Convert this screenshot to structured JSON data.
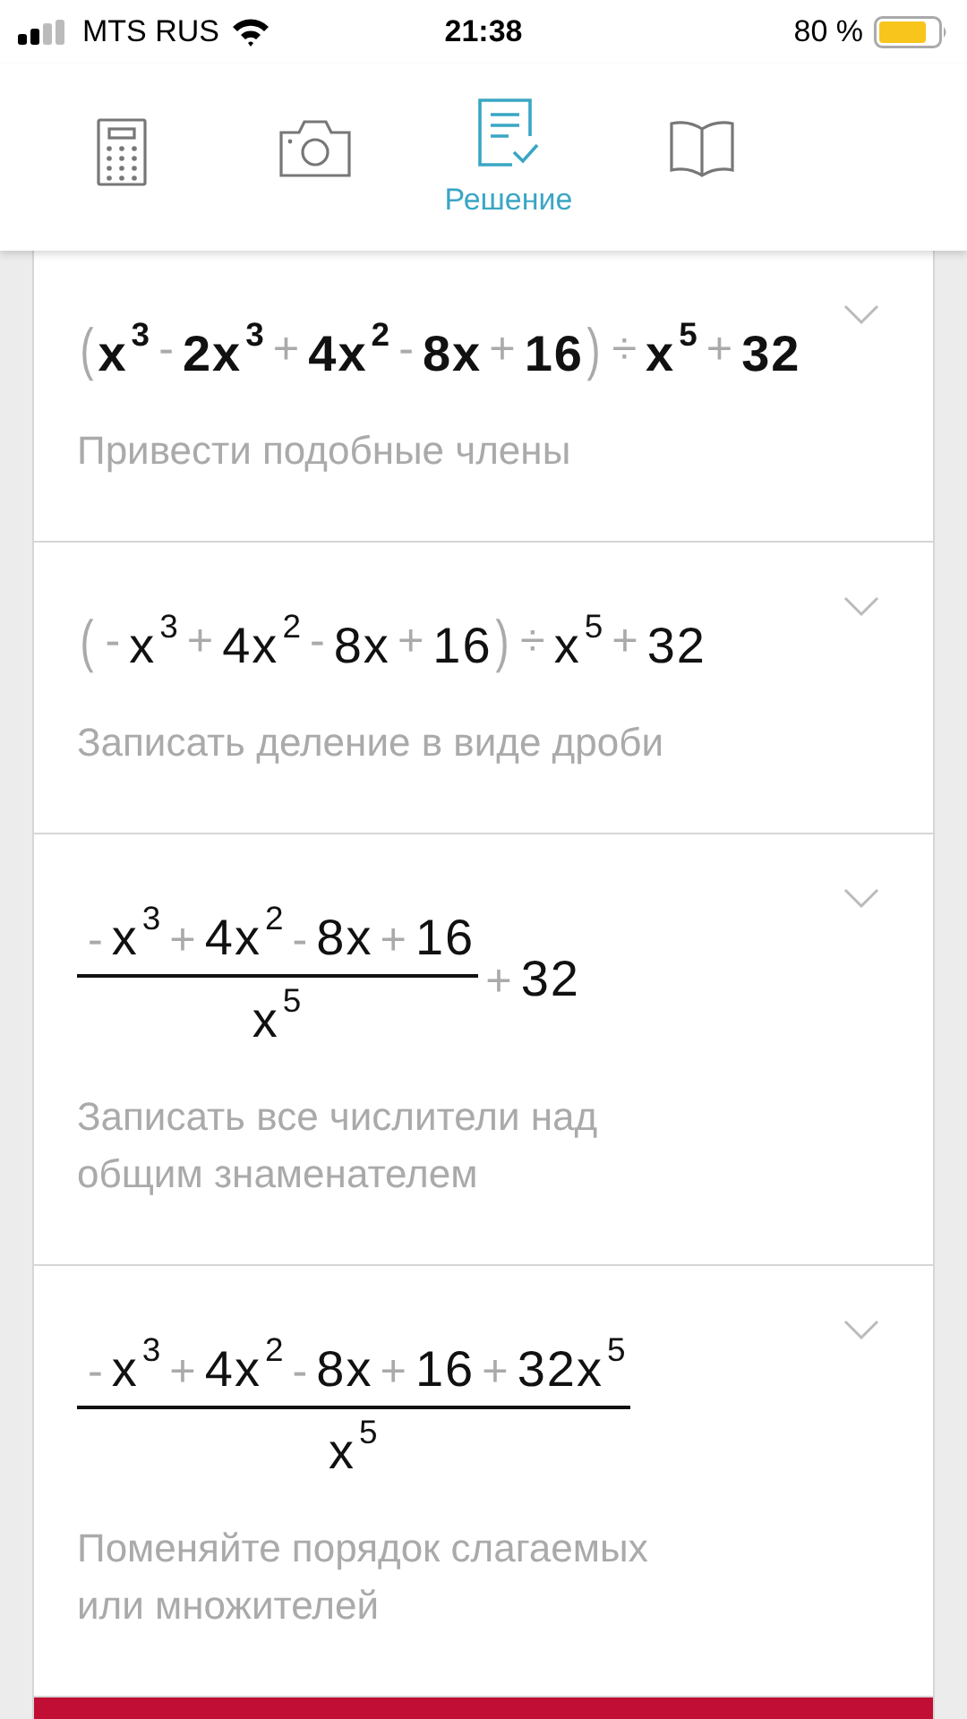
{
  "status_bar": {
    "carrier": "MTS RUS",
    "time": "21:38",
    "battery": "80 %"
  },
  "tabs": [
    {
      "kind": "calculator",
      "selected": false
    },
    {
      "kind": "camera",
      "selected": false
    },
    {
      "kind": "solution",
      "selected": true,
      "label": "Решение"
    },
    {
      "kind": "book",
      "selected": false
    }
  ],
  "steps": [
    {
      "bold": true,
      "formula": {
        "kind": "inline",
        "tokens": [
          {
            "kind": "paren",
            "text": "("
          },
          {
            "kind": "term",
            "text": "x",
            "sup": "3"
          },
          {
            "kind": "op",
            "text": "-"
          },
          {
            "kind": "term",
            "text": "2x",
            "sup": "3"
          },
          {
            "kind": "op",
            "text": "+"
          },
          {
            "kind": "term",
            "text": "4x",
            "sup": "2"
          },
          {
            "kind": "op",
            "text": "-"
          },
          {
            "kind": "term",
            "text": "8x"
          },
          {
            "kind": "op",
            "text": "+"
          },
          {
            "kind": "term",
            "text": "16"
          },
          {
            "kind": "paren",
            "text": ")"
          },
          {
            "kind": "op",
            "text": "÷"
          },
          {
            "kind": "term",
            "text": "x",
            "sup": "5"
          },
          {
            "kind": "op",
            "text": "+"
          },
          {
            "kind": "term",
            "text": "32"
          }
        ]
      },
      "hint": "Привести подобные члены"
    },
    {
      "bold": false,
      "formula": {
        "kind": "inline",
        "tokens": [
          {
            "kind": "paren",
            "text": "("
          },
          {
            "kind": "op",
            "text": "-"
          },
          {
            "kind": "term",
            "text": "x",
            "sup": "3"
          },
          {
            "kind": "op",
            "text": "+"
          },
          {
            "kind": "term",
            "text": "4x",
            "sup": "2"
          },
          {
            "kind": "op",
            "text": "-"
          },
          {
            "kind": "term",
            "text": "8x"
          },
          {
            "kind": "op",
            "text": "+"
          },
          {
            "kind": "term",
            "text": "16"
          },
          {
            "kind": "paren",
            "text": ")"
          },
          {
            "kind": "op",
            "text": "÷"
          },
          {
            "kind": "term",
            "text": "x",
            "sup": "5"
          },
          {
            "kind": "op",
            "text": "+"
          },
          {
            "kind": "term",
            "text": "32"
          }
        ]
      },
      "hint": "Записать деление в виде дроби"
    },
    {
      "bold": false,
      "formula": {
        "kind": "fraction",
        "numerator": [
          {
            "kind": "op",
            "text": "-"
          },
          {
            "kind": "term",
            "text": "x",
            "sup": "3"
          },
          {
            "kind": "op",
            "text": "+"
          },
          {
            "kind": "term",
            "text": "4x",
            "sup": "2"
          },
          {
            "kind": "op",
            "text": "-"
          },
          {
            "kind": "term",
            "text": "8x"
          },
          {
            "kind": "op",
            "text": "+"
          },
          {
            "kind": "term",
            "text": "16"
          }
        ],
        "denominator": [
          {
            "kind": "term",
            "text": "x",
            "sup": "5"
          }
        ],
        "after": [
          {
            "kind": "op",
            "text": "+"
          },
          {
            "kind": "term",
            "text": "32"
          }
        ]
      },
      "hint": "Записать все числители над общим знаменателем"
    },
    {
      "bold": false,
      "formula": {
        "kind": "fraction",
        "numerator": [
          {
            "kind": "op",
            "text": "-"
          },
          {
            "kind": "term",
            "text": "x",
            "sup": "3"
          },
          {
            "kind": "op",
            "text": "+"
          },
          {
            "kind": "term",
            "text": "4x",
            "sup": "2"
          },
          {
            "kind": "op",
            "text": "-"
          },
          {
            "kind": "term",
            "text": "8x"
          },
          {
            "kind": "op",
            "text": "+"
          },
          {
            "kind": "term",
            "text": "16"
          },
          {
            "kind": "op",
            "text": "+"
          },
          {
            "kind": "term",
            "text": "32x",
            "sup": "5"
          }
        ],
        "denominator": [
          {
            "kind": "term",
            "text": "x",
            "sup": "5"
          }
        ]
      },
      "hint": "Поменяйте порядок слагаемых или множителей"
    }
  ]
}
